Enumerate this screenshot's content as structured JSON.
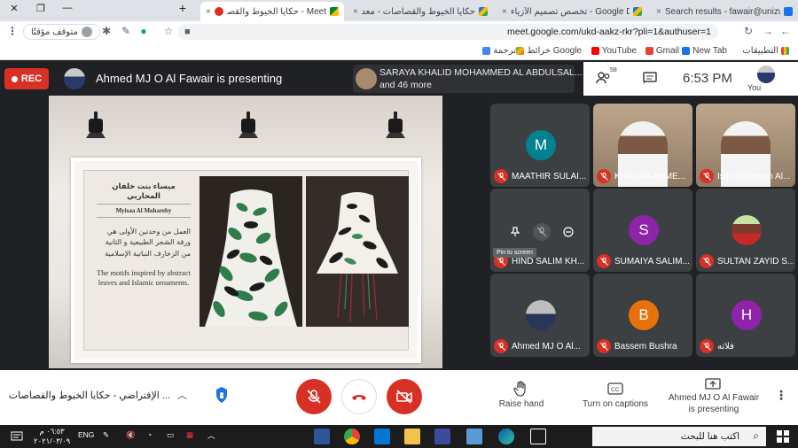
{
  "browser": {
    "tabs": [
      {
        "title": "Search results - fawair@unizwa.e",
        "close": "×"
      },
      {
        "title": "تخصص تصميم الأزياء - Google Drive",
        "close": "×"
      },
      {
        "title": "حكايا الخيوط والقصاصات - معدل",
        "close": "×"
      },
      {
        "title": "Meet - حكايا الخيوط والقصاصات",
        "close": "×"
      }
    ],
    "new_tab": "+",
    "url": "meet.google.com/ukd-aakz-rkr?pli=1&authuser=1",
    "paused_label": "متوقف مؤقتًا",
    "bookmarks": [
      {
        "label": "التطبيقات"
      },
      {
        "label": "New Tab"
      },
      {
        "label": "Gmail"
      },
      {
        "label": "YouTube"
      },
      {
        "label": "خرائط Google"
      },
      {
        "label": "ترجمة"
      }
    ]
  },
  "meet": {
    "rec_label": "REC",
    "presenting_title": "Ahmed MJ O Al Fawair is presenting",
    "presenters_name": "SARAYA KHALID MOHAMMED AL ABDULSAL...",
    "presenters_more": "and 46 more",
    "participant_count": "58",
    "clock": "6:53 PM",
    "you_label": "You",
    "presentation": {
      "name_ar": "ميساء بنت خلفان المحاربي",
      "name_en": "Myisaa Al Mohareby",
      "text_ar": "العمل من وحدتين الأولى هي ورقة الشجر الطبيعية و الثانية من الزخارف النباتية الإسلامية",
      "text_en": "The motifs inspired by abstract leaves and Islamic ornaments."
    },
    "tiles": [
      {
        "name": "MAATHIR SULAI...",
        "initial": "M",
        "color": "#00838f",
        "photo": false
      },
      {
        "name": "KHALIFA AHME...",
        "initial": "",
        "color": "",
        "photo": true
      },
      {
        "name": "Issa Sulaiman Al...",
        "initial": "",
        "color": "",
        "photo": true
      },
      {
        "name": "HIND SALIM KH...",
        "initial": "",
        "color": "",
        "photo": false
      },
      {
        "name": "SUMAIYA SALIM...",
        "initial": "S",
        "color": "#8e24aa",
        "photo": false
      },
      {
        "name": "SULTAN ZAYID S...",
        "initial": "",
        "color": "",
        "photo": true
      },
      {
        "name": "Ahmed MJ O Al...",
        "initial": "",
        "color": "",
        "photo": true
      },
      {
        "name": "Bassem Bushra",
        "initial": "B",
        "color": "#e8710a",
        "photo": false
      },
      {
        "name": "فلاته",
        "initial": "H",
        "color": "#8e24aa",
        "photo": false
      }
    ],
    "pin_tooltip": "Pin to screen",
    "meeting_name": "... الإفتراضي - حكايا الخيوط والقصاصات",
    "raise_hand": "Raise hand",
    "captions": "Turn on captions",
    "presenting_status_1": "Ahmed MJ O Al Fawair",
    "presenting_status_2": "is presenting"
  },
  "taskbar": {
    "search_placeholder": "اكتب هنا للبحث",
    "time": "٠٦:٥٣ م",
    "date": "٢٠٢١/٠٣/٠٩",
    "lang": "ENG"
  }
}
